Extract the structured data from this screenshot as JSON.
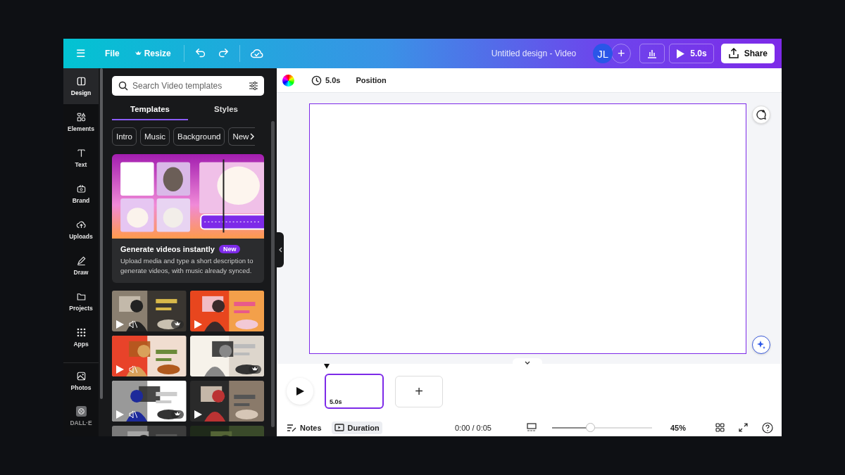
{
  "topbar": {
    "menu": "☰",
    "file": "File",
    "resize": "Resize",
    "title": "Untitled design - Video",
    "avatar": "JL",
    "add": "+",
    "play_time": "5.0s",
    "share": "Share"
  },
  "rail": [
    {
      "label": "Design",
      "selected": true
    },
    {
      "label": "Elements",
      "selected": false
    },
    {
      "label": "Text",
      "selected": false
    },
    {
      "label": "Brand",
      "selected": false
    },
    {
      "label": "Uploads",
      "selected": false
    },
    {
      "label": "Draw",
      "selected": false
    },
    {
      "label": "Projects",
      "selected": false
    },
    {
      "label": "Apps",
      "selected": false
    },
    {
      "label": "Photos",
      "selected": false
    },
    {
      "label": "DALL·E",
      "selected": false
    }
  ],
  "search": {
    "placeholder": "Search Video templates"
  },
  "tabs": [
    {
      "label": "Templates",
      "selected": true
    },
    {
      "label": "Styles",
      "selected": false
    }
  ],
  "chips": [
    "Intro",
    "Music",
    "Background",
    "New"
  ],
  "promo": {
    "title": "Generate videos instantly",
    "badge": "New",
    "text": "Upload media and type a short description to generate videos, with music already synced."
  },
  "templates": [
    {
      "kind": "picture",
      "video": true,
      "muted": true,
      "premium": true
    },
    {
      "kind": "picture",
      "video": true,
      "muted": false,
      "premium": false
    },
    {
      "kind": "picture",
      "video": true,
      "muted": true,
      "premium": false
    },
    {
      "kind": "picture",
      "video": false,
      "muted": false,
      "premium": true
    },
    {
      "kind": "picture",
      "video": true,
      "muted": true,
      "premium": true
    },
    {
      "kind": "picture",
      "video": true,
      "muted": false,
      "premium": false
    },
    {
      "kind": "picture"
    },
    {
      "kind": "picture"
    }
  ],
  "toolbar": {
    "duration": "5.0s",
    "position": "Position"
  },
  "timeline": {
    "clips": [
      {
        "duration": "5.0s",
        "selected": true
      }
    ],
    "add": "+"
  },
  "bottombar": {
    "notes": "Notes",
    "duration": {
      "label": "Duration",
      "selected": true
    },
    "time": "0:00 / 0:05",
    "zoom": {
      "level": 0.39
    },
    "zoom_label": "45%"
  }
}
